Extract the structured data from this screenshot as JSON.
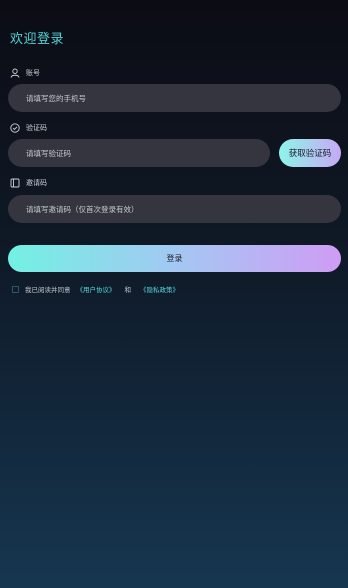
{
  "page_title": "欢迎登录",
  "account": {
    "label": "账号",
    "placeholder": "请填写您的手机号"
  },
  "code": {
    "label": "验证码",
    "placeholder": "请填写验证码",
    "get_code_button": "获取验证码"
  },
  "invite": {
    "label": "邀请码",
    "placeholder": "请填写邀请码（仅首次登录有效）"
  },
  "login_button": "登录",
  "agreement": {
    "prefix": "我已阅读并同意",
    "user_agreement": "《用户协议》",
    "and": "和",
    "privacy_policy": "《隐私政策》"
  },
  "colors": {
    "accent": "#4fd3d6",
    "gradient_start": "#72f1e3",
    "gradient_end": "#cf9cf4",
    "input_bg": "#34353e"
  },
  "icons": {
    "account": "user-icon",
    "code": "shield-check-icon",
    "invite": "invite-card-icon"
  }
}
